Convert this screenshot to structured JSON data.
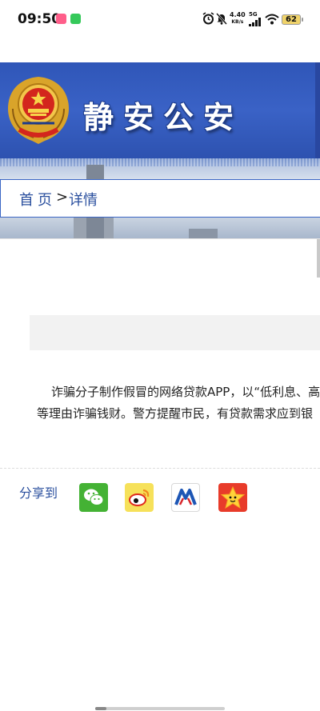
{
  "status_bar": {
    "time": "09:50",
    "net_speed_value": "4.40",
    "net_speed_unit": "KB/s",
    "network": "5G",
    "battery": "62",
    "icons": [
      "alarm-icon",
      "mute-icon",
      "signal-icon",
      "wifi-icon",
      "battery-icon"
    ]
  },
  "header": {
    "site_title": "静安公安",
    "emblem": "police-emblem-icon"
  },
  "breadcrumb": {
    "home": "首页",
    "separator": ">",
    "current": "详情"
  },
  "article": {
    "line1": "诈骗分子制作假冒的网络贷款APP，以“低利息、高",
    "line2": "等理由诈骗钱财。警方提醒市民，有贷款需求应到银"
  },
  "share": {
    "label": "分享到",
    "targets": [
      "wechat-icon",
      "weibo-icon",
      "renren-icon",
      "qzone-icon"
    ]
  },
  "colors": {
    "header_blue": "#3a62c6",
    "link_blue": "#2a4f9e"
  }
}
